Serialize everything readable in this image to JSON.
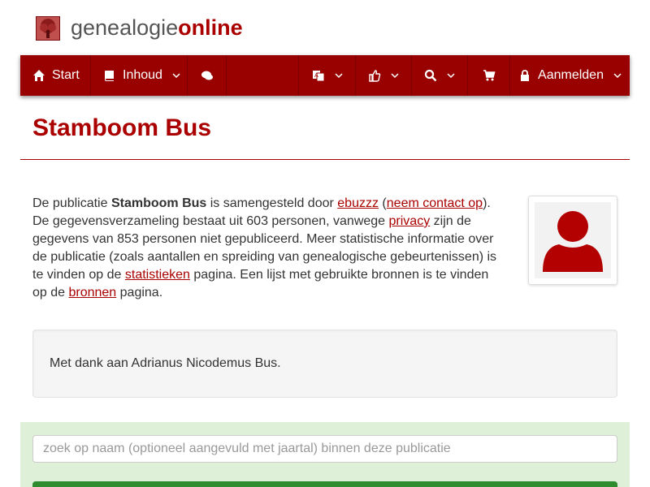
{
  "brand": {
    "part1": "genealogie",
    "part2": "online"
  },
  "nav": {
    "start": "Start",
    "inhoud": "Inhoud",
    "aanmelden": "Aanmelden"
  },
  "page": {
    "title": "Stamboom Bus",
    "desc": {
      "t1": "De publicatie ",
      "pub": "Stamboom Bus",
      "t2": " is samengesteld door ",
      "author": "ebuzzz",
      "t3": " (",
      "contact": "neem contact op",
      "t4": "). De gegevensverzameling bestaat uit 603 personen, vanwege ",
      "privacy": "privacy",
      "t5": " zijn de gegevens van 853 personen niet gepubliceerd. Meer statistische informatie over de publicatie (zoals aantallen en spreiding van genealogische gebeurtenissen) is te vinden op de ",
      "stats": "statistieken",
      "t6": " pagina. Een lijst met gebruikte bronnen is te vinden op de ",
      "sources": "bronnen",
      "t7": " pagina."
    },
    "thanks": "Met dank aan Adrianus Nicodemus Bus."
  },
  "search": {
    "placeholder": "zoek op naam (optioneel aangevuld met jaartal) binnen deze publicatie",
    "value": ""
  },
  "colors": {
    "accent": "#990000",
    "link": "#aa0000",
    "search_band": "#dff0d8"
  },
  "icons": [
    "home-icon",
    "book-icon",
    "comments-icon",
    "language-icon",
    "thumbs-up-icon",
    "search-icon",
    "cart-icon",
    "lock-icon",
    "chevron-down-icon",
    "user-avatar-icon"
  ]
}
